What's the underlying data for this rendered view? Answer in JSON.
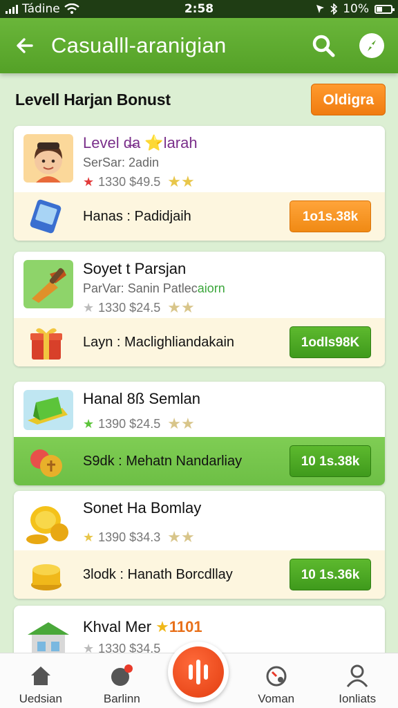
{
  "status_bar": {
    "carrier": "Tádine",
    "time": "2:58",
    "battery": "10%"
  },
  "app_bar": {
    "title": "Casualll-aranigian"
  },
  "section": {
    "title": "Levell Harjan Bonust",
    "button_label": "Oldigra"
  },
  "cards": [
    {
      "title": "Level  d̶a  ⭐larah",
      "subtitle": "SerSar: 2adin",
      "subtitle_accent": "",
      "stats": "1330  $49.5",
      "thumb_icon": "girl-avatar-icon",
      "reward_icon": "tablet-icon",
      "reward_text": "Hanas : Padidjaih",
      "reward_button": "1o1s.38k",
      "button_color": "orange"
    },
    {
      "title": "Soyet t Parsjan",
      "subtitle": "ParVar: Sanin  Patlec",
      "subtitle_accent": "aiorn",
      "stats": "1330  $24.5",
      "thumb_icon": "hammer-tool-icon",
      "reward_icon": "gift-box-icon",
      "reward_text": "Layn : Maclighliandakain",
      "reward_button": "1odls98K",
      "button_color": "green"
    },
    {
      "title": "Hanal 8ß Semlan",
      "subtitle": "",
      "subtitle_accent": "",
      "stats": "1390  $24.5",
      "thumb_icon": "green-box-icon",
      "reward_icon": "fruit-bag-icon",
      "reward_text": "S9dk : Mehatn Nandarliay",
      "reward_button": "10 1s.38k",
      "button_color": "green"
    },
    {
      "title": "Sonet Ha Bomlay",
      "subtitle": "",
      "subtitle_accent": "",
      "stats": "1390  $34.3",
      "thumb_icon": "gold-coins-icon",
      "reward_icon": "coin-stack-icon",
      "reward_text": "3lodk : Hanath Borcdllay",
      "reward_button": "10 1s.36k",
      "button_color": "green"
    },
    {
      "title": "Khval Mer",
      "title_badge": "1101",
      "stats": "1330  $34.5",
      "thumb_icon": "shop-building-icon"
    }
  ],
  "bottom_nav": {
    "items": [
      {
        "label": "Uedsian",
        "icon": "home-icon"
      },
      {
        "label": "Barlinn",
        "icon": "notification-icon"
      },
      {
        "label": "Voman",
        "icon": "timer-icon"
      },
      {
        "label": "Ionliats",
        "icon": "profile-icon"
      }
    ]
  }
}
